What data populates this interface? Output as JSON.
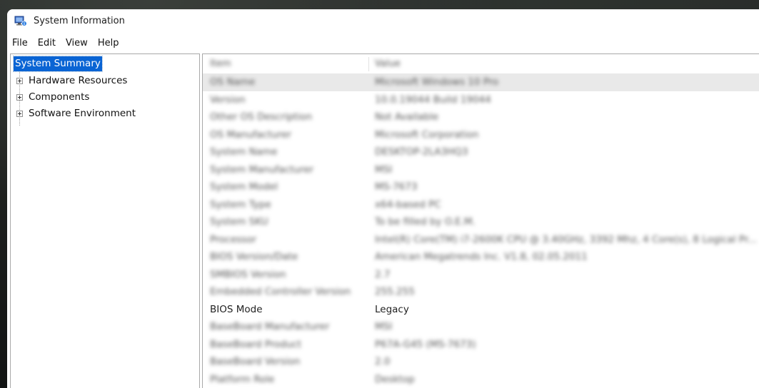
{
  "window": {
    "title": "System Information"
  },
  "menu": [
    "File",
    "Edit",
    "View",
    "Help"
  ],
  "tree": {
    "root": "System Summary",
    "children": [
      "Hardware Resources",
      "Components",
      "Software Environment"
    ]
  },
  "table": {
    "columns": [
      "Item",
      "Value"
    ],
    "rows": [
      {
        "item": "OS Name",
        "value": "Microsoft Windows 10 Pro",
        "blurred": true,
        "selected": true
      },
      {
        "item": "Version",
        "value": "10.0.19044 Build 19044",
        "blurred": true
      },
      {
        "item": "Other OS Description",
        "value": "Not Available",
        "blurred": true
      },
      {
        "item": "OS Manufacturer",
        "value": "Microsoft Corporation",
        "blurred": true
      },
      {
        "item": "System Name",
        "value": "DESKTOP-2LA3HQ3",
        "blurred": true
      },
      {
        "item": "System Manufacturer",
        "value": "MSI",
        "blurred": true
      },
      {
        "item": "System Model",
        "value": "MS-7673",
        "blurred": true
      },
      {
        "item": "System Type",
        "value": "x64-based PC",
        "blurred": true
      },
      {
        "item": "System SKU",
        "value": "To be filled by O.E.M.",
        "blurred": true
      },
      {
        "item": "Processor",
        "value": "Intel(R) Core(TM) i7-2600K CPU @ 3.40GHz, 3392 Mhz, 4 Core(s), 8 Logical Pr...",
        "blurred": true
      },
      {
        "item": "BIOS Version/Date",
        "value": "American Megatrends Inc. V1.8, 02.05.2011",
        "blurred": true
      },
      {
        "item": "SMBIOS Version",
        "value": "2.7",
        "blurred": true
      },
      {
        "item": "Embedded Controller Version",
        "value": "255.255",
        "blurred": true
      },
      {
        "item": "BIOS Mode",
        "value": "Legacy",
        "blurred": false
      },
      {
        "item": "BaseBoard Manufacturer",
        "value": "MSI",
        "blurred": true
      },
      {
        "item": "BaseBoard Product",
        "value": "P67A-G45 (MS-7673)",
        "blurred": true
      },
      {
        "item": "BaseBoard Version",
        "value": "2.0",
        "blurred": true
      },
      {
        "item": "Platform Role",
        "value": "Desktop",
        "blurred": true
      }
    ]
  },
  "colors": {
    "selection": "#0a64d4",
    "border": "#a9a9a9"
  },
  "icons": {
    "app": "system-information-icon"
  }
}
